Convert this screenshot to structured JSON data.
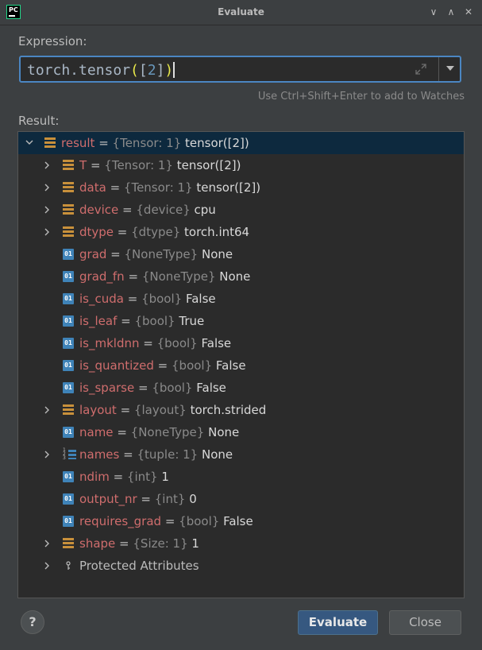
{
  "window": {
    "title": "Evaluate",
    "minimize": "∨",
    "maximize": "∧",
    "close": "✕"
  },
  "logo_text": "PC",
  "expression": {
    "label": "Expression:",
    "text_prefix": "torch.tensor",
    "open_paren": "(",
    "open_bracket": "[",
    "number": "2",
    "close_bracket": "]",
    "close_paren": ")"
  },
  "hint": "Use Ctrl+Shift+Enter to add to Watches",
  "result_label": "Result:",
  "tree": [
    {
      "name": "result",
      "type": "{Tensor: 1}",
      "value": "tensor([2])",
      "icon": "object-icon",
      "arrow": "expanded",
      "selected": true
    },
    {
      "name": "T",
      "type": "{Tensor: 1}",
      "value": "tensor([2])",
      "icon": "object-icon",
      "arrow": "collapsed"
    },
    {
      "name": "data",
      "type": "{Tensor: 1}",
      "value": "tensor([2])",
      "icon": "object-icon",
      "arrow": "collapsed"
    },
    {
      "name": "device",
      "type": "{device}",
      "value": "cpu",
      "icon": "object-icon",
      "arrow": "collapsed"
    },
    {
      "name": "dtype",
      "type": "{dtype}",
      "value": "torch.int64",
      "icon": "object-icon",
      "arrow": "collapsed"
    },
    {
      "name": "grad",
      "type": "{NoneType}",
      "value": "None",
      "icon": "primitive-icon",
      "arrow": "none"
    },
    {
      "name": "grad_fn",
      "type": "{NoneType}",
      "value": "None",
      "icon": "primitive-icon",
      "arrow": "none"
    },
    {
      "name": "is_cuda",
      "type": "{bool}",
      "value": "False",
      "icon": "primitive-icon",
      "arrow": "none"
    },
    {
      "name": "is_leaf",
      "type": "{bool}",
      "value": "True",
      "icon": "primitive-icon",
      "arrow": "none"
    },
    {
      "name": "is_mkldnn",
      "type": "{bool}",
      "value": "False",
      "icon": "primitive-icon",
      "arrow": "none"
    },
    {
      "name": "is_quantized",
      "type": "{bool}",
      "value": "False",
      "icon": "primitive-icon",
      "arrow": "none"
    },
    {
      "name": "is_sparse",
      "type": "{bool}",
      "value": "False",
      "icon": "primitive-icon",
      "arrow": "none"
    },
    {
      "name": "layout",
      "type": "{layout}",
      "value": "torch.strided",
      "icon": "object-icon",
      "arrow": "collapsed"
    },
    {
      "name": "name",
      "type": "{NoneType}",
      "value": "None",
      "icon": "primitive-icon",
      "arrow": "none"
    },
    {
      "name": "names",
      "type": "{tuple: 1}",
      "value": "None",
      "icon": "list-icon",
      "arrow": "collapsed"
    },
    {
      "name": "ndim",
      "type": "{int}",
      "value": "1",
      "icon": "primitive-icon",
      "arrow": "none"
    },
    {
      "name": "output_nr",
      "type": "{int}",
      "value": "0",
      "icon": "primitive-icon",
      "arrow": "none"
    },
    {
      "name": "requires_grad",
      "type": "{bool}",
      "value": "False",
      "icon": "primitive-icon",
      "arrow": "none"
    },
    {
      "name": "shape",
      "type": "{Size: 1}",
      "value": "1",
      "icon": "object-icon",
      "arrow": "collapsed"
    },
    {
      "name": "Protected Attributes",
      "type": "",
      "value": "",
      "icon": "key-icon",
      "arrow": "collapsed",
      "plain": true
    }
  ],
  "primitive_icon_text": "01",
  "list_icon_text": "1 2 3",
  "buttons": {
    "help": "?",
    "evaluate": "Evaluate",
    "close": "Close"
  },
  "colors": {
    "background": "#3c3f41",
    "field_background": "#2b2b2b",
    "focus_border": "#4b86c2",
    "selection": "#0d293e",
    "name": "#cf6d6d",
    "primary_button": "#365880"
  }
}
